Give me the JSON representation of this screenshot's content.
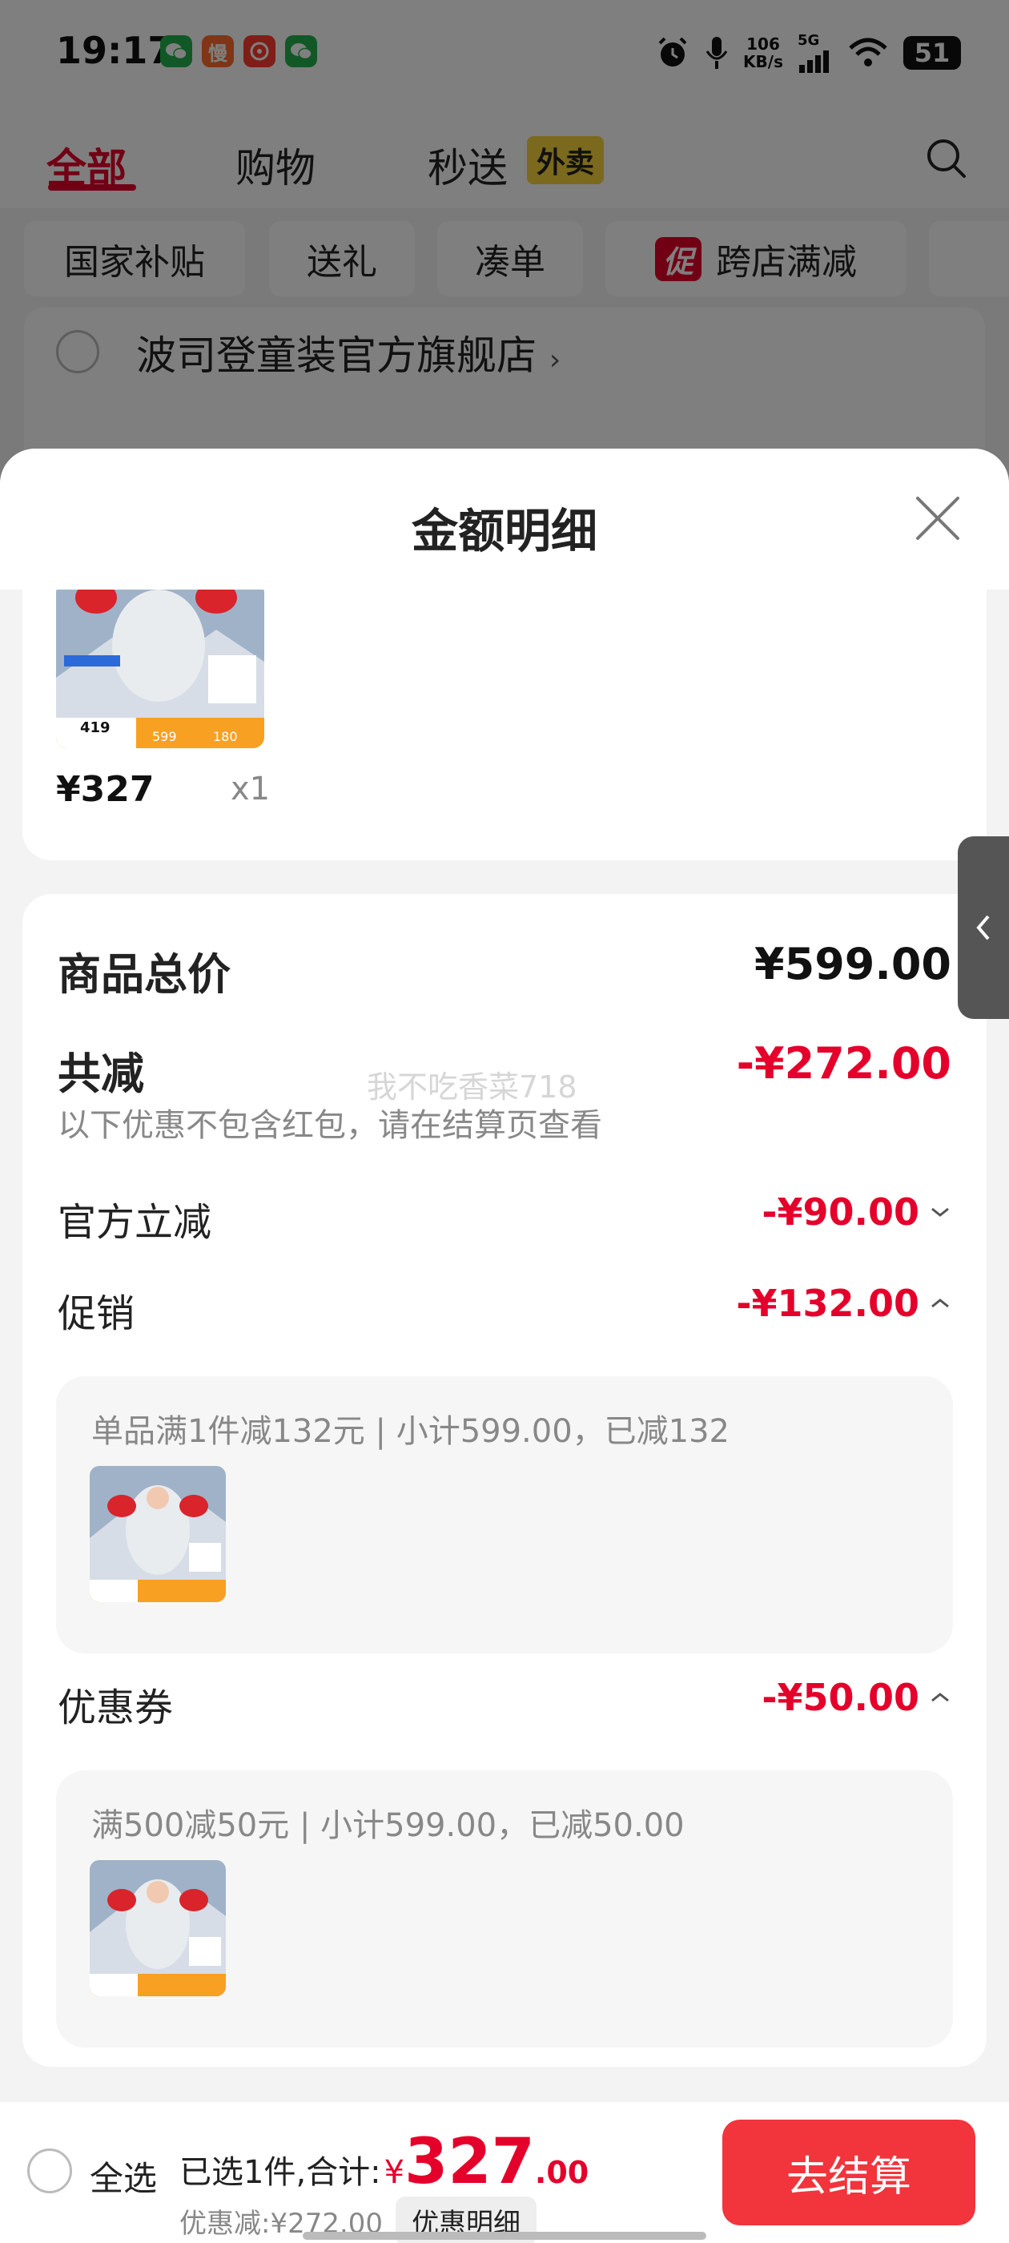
{
  "status_bar": {
    "time": "19:17",
    "net_speed_value": "106",
    "net_speed_unit": "KB/s",
    "network": "5G",
    "battery": "51",
    "apps": [
      {
        "icon": "wechat-icon",
        "color": "#22b14c",
        "glyph": ""
      },
      {
        "icon": "man-app-icon",
        "color": "#ff6a2c",
        "glyph": "慢"
      },
      {
        "icon": "taobao-icon",
        "color": "#ff3d2c",
        "glyph": ""
      },
      {
        "icon": "wechat-icon",
        "color": "#22b14c",
        "glyph": ""
      }
    ]
  },
  "top_tabs": {
    "all": "全部",
    "shopping": "购物",
    "express": "秒送",
    "express_badge": "外卖"
  },
  "chips": {
    "national_subsidy": "国家补贴",
    "gift": "送礼",
    "combine": "凑单",
    "promo_badge": "促",
    "cross_store": "跨店满减"
  },
  "store": {
    "name": "波司登童装官方旗舰店",
    "arrow": "›"
  },
  "sheet": {
    "title": "金额明细",
    "item": {
      "price": "¥327",
      "qty": "x1",
      "thumb_price": "419",
      "thumb_tag1": "599",
      "thumb_tag2": "180"
    },
    "total_label": "商品总价",
    "total_value": "¥599.00",
    "reduce_label": "共减",
    "reduce_value": "-¥272.00",
    "reduce_note": "以下优惠不包含红包，请在结算页查看",
    "official_label": "官方立减",
    "official_value": "-¥90.00",
    "promo_label": "促销",
    "promo_value": "-¥132.00",
    "promo_detail": "单品满1件减132元 | 小计599.00，已减132",
    "coupon_label": "优惠券",
    "coupon_value": "-¥50.00",
    "coupon_detail": "满500减50元 | 小计599.00，已减50.00",
    "watermark": "我不吃香菜718"
  },
  "bottom": {
    "select_all": "全选",
    "selected_text": "已选1件,合计:",
    "yen": "¥",
    "total_int": "327",
    "total_dec": ".00",
    "discount": "优惠减:¥272.00",
    "detail_button": "优惠明细",
    "checkout": "去结算"
  },
  "colors": {
    "brand_red": "#e4002b",
    "checkout_red": "#f2343c"
  }
}
